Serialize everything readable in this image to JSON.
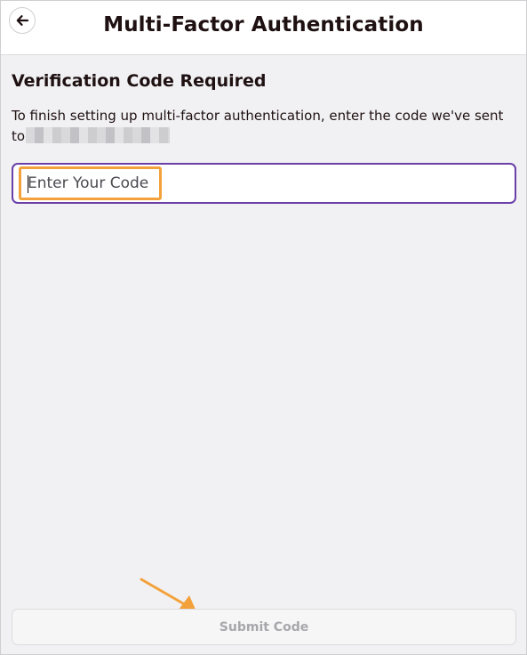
{
  "header": {
    "title": "Multi-Factor Authentication",
    "back_icon": "left-arrow-icon"
  },
  "content": {
    "heading": "Verification Code Required",
    "description": "To finish setting up multi-factor authentication, enter the code we've sent",
    "recipient_prefix": "to",
    "recipient_masked": ""
  },
  "form": {
    "code_placeholder": "Enter Your Code",
    "code_value": ""
  },
  "footer": {
    "submit_label": "Submit Code"
  },
  "colors": {
    "accent_border": "#6b3fa8",
    "highlight": "#f3a13a",
    "disabled_text": "#a7a7ac",
    "text": "#1f1112"
  }
}
